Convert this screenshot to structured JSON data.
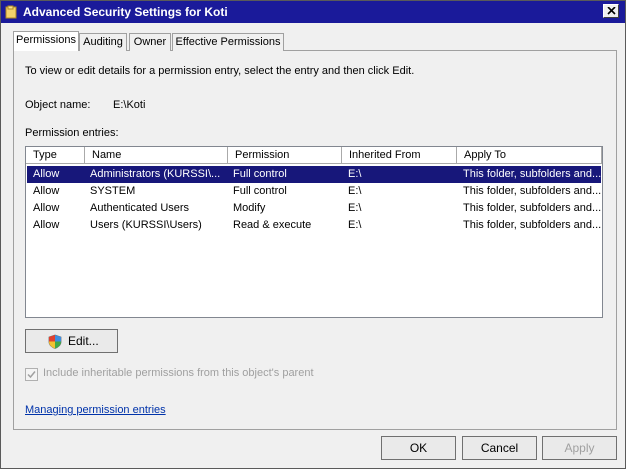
{
  "window": {
    "title": "Advanced Security Settings for Koti",
    "title_icon": "folder-icon",
    "close_icon": "close-icon"
  },
  "tabs": [
    {
      "label": "Permissions",
      "active": true
    },
    {
      "label": "Auditing",
      "active": false
    },
    {
      "label": "Owner",
      "active": false
    },
    {
      "label": "Effective Permissions",
      "active": false
    }
  ],
  "permissions": {
    "description": "To view or edit details for a permission entry, select the entry and then click Edit.",
    "object_name_label": "Object name:",
    "object_name_value": "E:\\Koti",
    "entries_label": "Permission entries:",
    "columns": [
      "Type",
      "Name",
      "Permission",
      "Inherited From",
      "Apply To"
    ],
    "rows": [
      {
        "type": "Allow",
        "name": "Administrators (KURSSI\\...",
        "permission": "Full control",
        "inherited_from": "E:\\",
        "apply_to": "This folder, subfolders and...",
        "selected": true
      },
      {
        "type": "Allow",
        "name": "SYSTEM",
        "permission": "Full control",
        "inherited_from": "E:\\",
        "apply_to": "This folder, subfolders and...",
        "selected": false
      },
      {
        "type": "Allow",
        "name": "Authenticated Users",
        "permission": "Modify",
        "inherited_from": "E:\\",
        "apply_to": "This folder, subfolders and...",
        "selected": false
      },
      {
        "type": "Allow",
        "name": "Users (KURSSI\\Users)",
        "permission": "Read & execute",
        "inherited_from": "E:\\",
        "apply_to": "This folder, subfolders and...",
        "selected": false
      }
    ],
    "edit_button": "Edit...",
    "edit_icon": "shield-icon",
    "inherit_checkbox_label": "Include inheritable permissions from this object's parent",
    "inherit_checked": true,
    "inherit_enabled": false,
    "help_link": "Managing permission entries"
  },
  "footer": {
    "ok": "OK",
    "cancel": "Cancel",
    "apply": "Apply"
  },
  "colors": {
    "titlebar": "#1a1a9a",
    "selection": "#17177a",
    "link": "#0033aa"
  }
}
